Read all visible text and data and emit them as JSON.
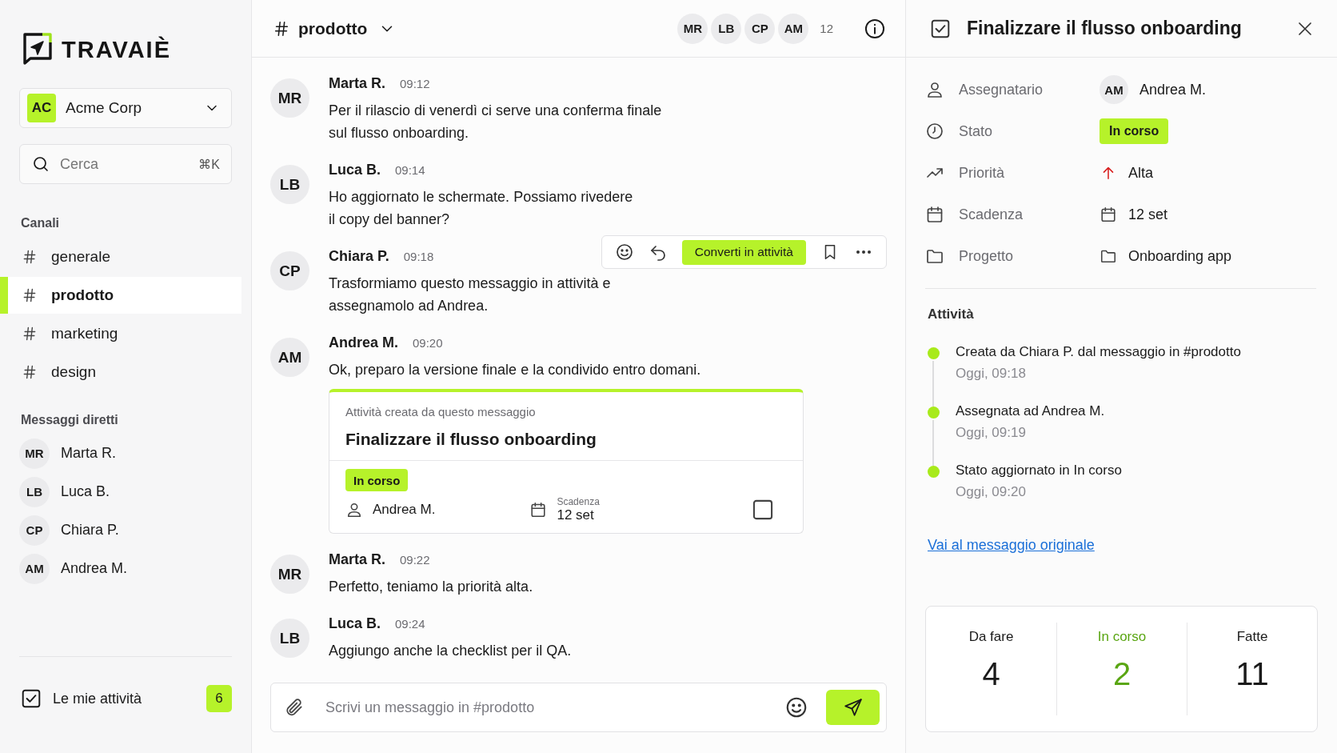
{
  "sidebar": {
    "logo": "TRAVAIÈ",
    "workspace": {
      "initials": "AC",
      "name": "Acme Corp"
    },
    "search": {
      "placeholder": "Cerca",
      "shortcut": "⌘K"
    },
    "channels_heading": "Canali",
    "channels": [
      {
        "name": "generale",
        "selected": false
      },
      {
        "name": "prodotto",
        "selected": true
      },
      {
        "name": "marketing",
        "selected": false
      },
      {
        "name": "design",
        "selected": false
      }
    ],
    "dm_heading": "Messaggi diretti",
    "direct_messages": [
      {
        "initials": "MR",
        "name": "Marta R."
      },
      {
        "initials": "LB",
        "name": "Luca B."
      },
      {
        "initials": "CP",
        "name": "Chiara P."
      },
      {
        "initials": "AM",
        "name": "Andrea M."
      }
    ],
    "my_tasks": {
      "label": "Le mie attività",
      "checked": true,
      "count": "6"
    }
  },
  "channel": {
    "name": "prodotto",
    "members": [
      "MR",
      "LB",
      "CP",
      "AM"
    ],
    "member_count": "12",
    "messages": [
      {
        "initials": "MR",
        "author": "Marta R.",
        "time": "09:12",
        "lines": [
          "Per il rilascio di venerdì ci serve una conferma finale",
          "sul flusso onboarding."
        ]
      },
      {
        "initials": "LB",
        "author": "Luca B.",
        "time": "09:14",
        "lines": [
          "Ho aggiornato le schermate. Possiamo rivedere",
          "il copy del banner?"
        ]
      },
      {
        "initials": "CP",
        "author": "Chiara P.",
        "time": "09:18",
        "lines": [
          "Trasformiamo questo messaggio in attività e",
          "assegnamolo ad Andrea."
        ],
        "toolbar": {
          "action": "Converti in attività"
        }
      },
      {
        "initials": "AM",
        "author": "Andrea M.",
        "time": "09:20",
        "lines": [
          "Ok, preparo la versione finale e la condivido entro domani."
        ],
        "task_card": {
          "caption": "Attività creata da questo messaggio",
          "title": "Finalizzare il flusso onboarding",
          "status": "In corso",
          "assignee": "Andrea M.",
          "due_label": "Scadenza",
          "due": "12 set",
          "done": false
        }
      },
      {
        "initials": "MR",
        "author": "Marta R.",
        "time": "09:22",
        "lines": [
          "Perfetto, teniamo la priorità alta."
        ]
      },
      {
        "initials": "LB",
        "author": "Luca B.",
        "time": "09:24",
        "lines": [
          "Aggiungo anche la checklist per il QA."
        ]
      }
    ],
    "composer": {
      "placeholder": "Scrivi un messaggio in #prodotto"
    }
  },
  "task_panel": {
    "title": "Finalizzare il flusso onboarding",
    "fields": [
      {
        "kind": "assignee",
        "label": "Assegnatario",
        "initials": "AM",
        "value": "Andrea M."
      },
      {
        "kind": "status",
        "label": "Stato",
        "value": "In corso"
      },
      {
        "kind": "priority",
        "label": "Priorità",
        "value": "Alta"
      },
      {
        "kind": "date",
        "label": "Scadenza",
        "value": "12 set"
      },
      {
        "kind": "project",
        "label": "Progetto",
        "value": "Onboarding app"
      }
    ],
    "activity_heading": "Attività",
    "activity": [
      {
        "text": "Creata da Chiara P. dal messaggio in #prodotto",
        "time": "Oggi, 09:18"
      },
      {
        "text": "Assegnata ad Andrea M.",
        "time": "Oggi, 09:19"
      },
      {
        "text": "Stato aggiornato in In corso",
        "time": "Oggi, 09:20"
      }
    ],
    "link": "Vai al messaggio originale",
    "stats": [
      {
        "label": "Da fare",
        "value": "4",
        "highlighted": false
      },
      {
        "label": "In corso",
        "value": "2",
        "highlighted": true
      },
      {
        "label": "Fatte",
        "value": "11",
        "highlighted": false
      }
    ]
  }
}
